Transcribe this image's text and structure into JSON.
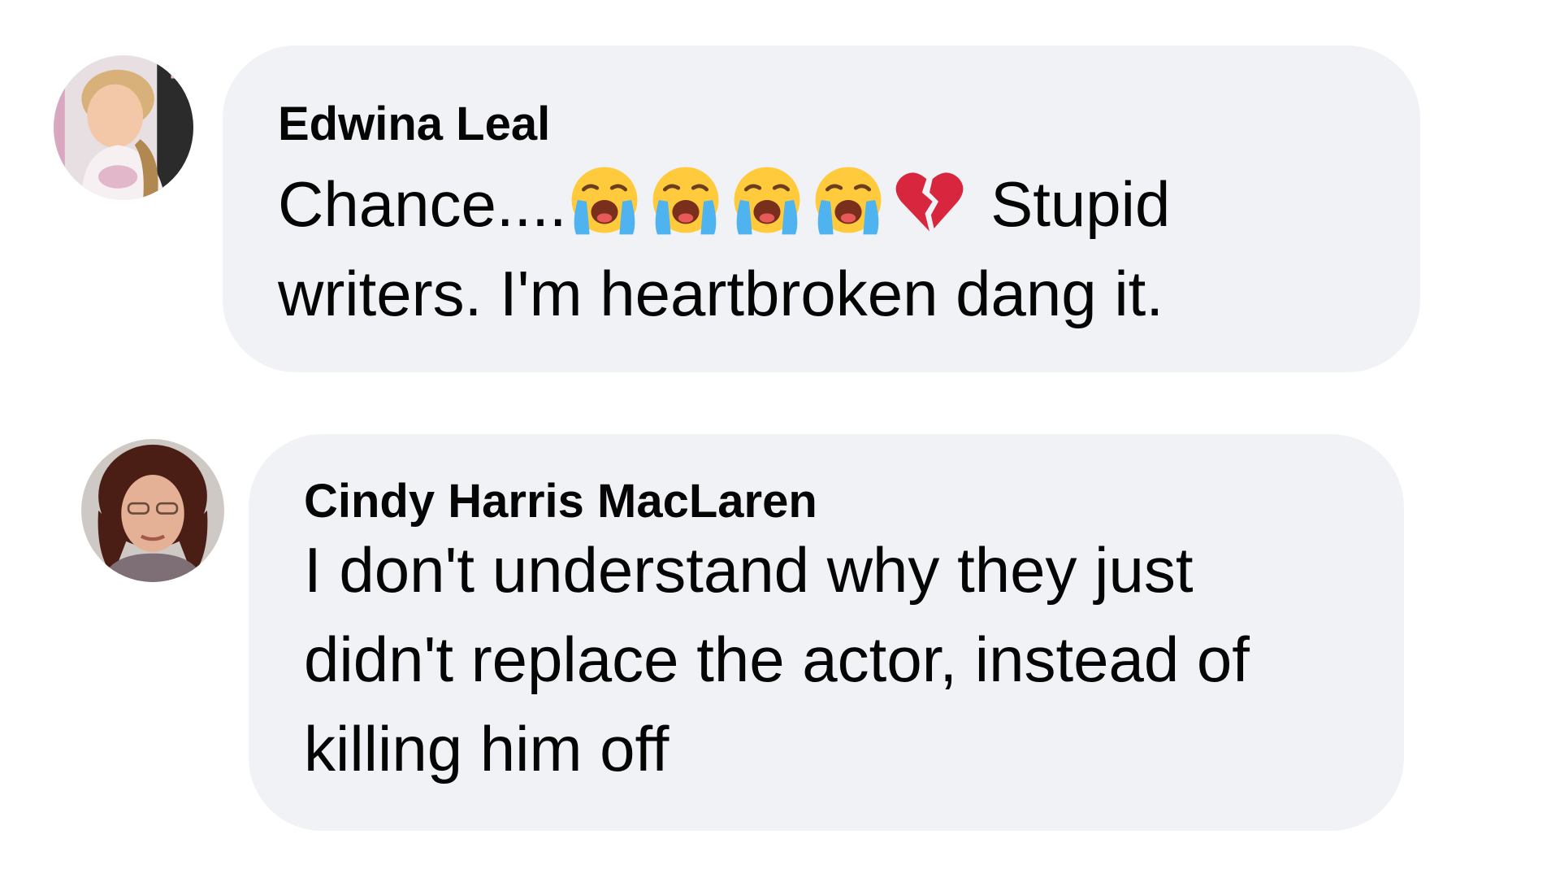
{
  "comments": [
    {
      "author": "Edwina Leal",
      "avatar": "profile-photo",
      "lines": [
        {
          "before": "Chance....",
          "emojis": [
            "crying-face",
            "crying-face",
            "crying-face",
            "crying-face",
            "broken-heart"
          ],
          "after": " Stupid"
        },
        {
          "text": "writers. I'm heartbroken dang it."
        }
      ]
    },
    {
      "author": "Cindy Harris MacLaren",
      "avatar": "profile-photo",
      "lines": [
        "I don't understand why they just",
        "didn't replace the actor, instead of",
        "killing him off"
      ]
    }
  ],
  "colors": {
    "bubble": "#f0f2f5",
    "text": "#050505"
  }
}
